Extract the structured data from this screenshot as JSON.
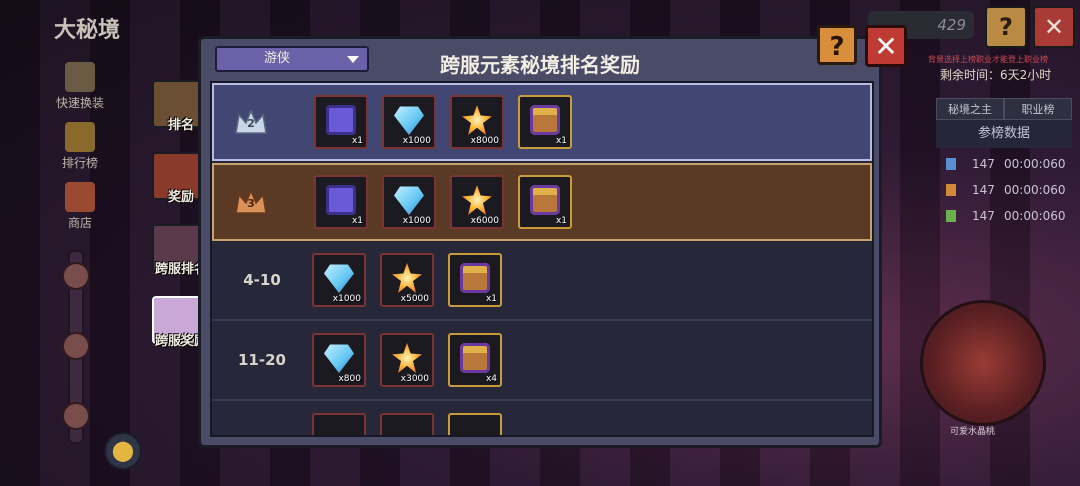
{
  "page": {
    "title": "大秘境"
  },
  "side_menu": [
    {
      "label": "快速换装",
      "icon": "armor-swap-icon"
    },
    {
      "label": "排行榜",
      "icon": "trophy-icon"
    },
    {
      "label": "商店",
      "icon": "shop-icon"
    }
  ],
  "tabs": [
    {
      "label": "排名",
      "icon": "trophy-icon",
      "active": false
    },
    {
      "label": "奖励",
      "icon": "reward-chest-icon",
      "active": false
    },
    {
      "label": "跨服排名",
      "icon": "crest-icon",
      "active": false
    },
    {
      "label": "跨服奖励",
      "icon": "gift-chest-icon",
      "active": true
    }
  ],
  "hud": {
    "coins": "429",
    "help_label": "?",
    "close_label": "✕"
  },
  "right_panel": {
    "warning": "背景选择上榜职业才能登上职业榜",
    "timer": "剩余时间：6天2小时",
    "tabs": [
      "秘境之主",
      "职业榜"
    ],
    "header": "参榜数据",
    "rows": [
      {
        "count": "147",
        "time": "00:00:060",
        "gem_color": "#5a8fd0"
      },
      {
        "count": "147",
        "time": "00:00:060",
        "gem_color": "#d08a3a"
      },
      {
        "count": "147",
        "time": "00:00:060",
        "gem_color": "#6ab04c"
      }
    ],
    "avatar_name": "可爱水晶桃"
  },
  "dialog": {
    "title": "跨服元素秘境排名奖励",
    "class_select": "游侠",
    "help_label": "?",
    "close_label": "✕"
  },
  "reward_rows": [
    {
      "rank": "2",
      "crown": "silver",
      "items": [
        {
          "icon": "skill-card-icon",
          "qty": "x1"
        },
        {
          "icon": "diamond-icon",
          "qty": "x1000"
        },
        {
          "icon": "gold-star-icon",
          "qty": "x8000"
        },
        {
          "icon": "treasure-chest-icon",
          "qty": "x1"
        }
      ]
    },
    {
      "rank": "3",
      "crown": "bronze",
      "items": [
        {
          "icon": "skill-card-icon",
          "qty": "x1"
        },
        {
          "icon": "diamond-icon",
          "qty": "x1000"
        },
        {
          "icon": "gold-star-icon",
          "qty": "x6000"
        },
        {
          "icon": "treasure-chest-icon",
          "qty": "x1"
        }
      ]
    },
    {
      "rank": "4-10",
      "items": [
        {
          "icon": "diamond-icon",
          "qty": "x1000"
        },
        {
          "icon": "gold-star-icon",
          "qty": "x5000"
        },
        {
          "icon": "treasure-chest-icon",
          "qty": "x1"
        }
      ]
    },
    {
      "rank": "11-20",
      "items": [
        {
          "icon": "diamond-icon",
          "qty": "x800"
        },
        {
          "icon": "gold-star-icon",
          "qty": "x3000"
        },
        {
          "icon": "treasure-chest-icon",
          "qty": "x4"
        }
      ]
    }
  ]
}
